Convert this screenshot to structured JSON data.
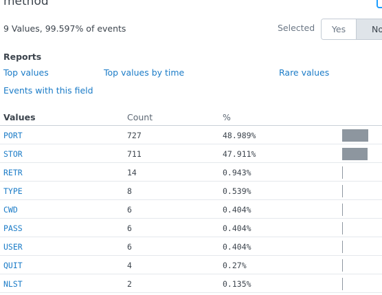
{
  "field_name": "method",
  "summary": "9 Values, 99.597% of events",
  "selected": {
    "label": "Selected",
    "yes": "Yes",
    "no": "No",
    "value": "No"
  },
  "reports": {
    "heading": "Reports",
    "links": [
      "Top values",
      "Top values by time",
      "Rare values",
      "Events with this field"
    ]
  },
  "table": {
    "headers": {
      "values": "Values",
      "count": "Count",
      "percent": "%"
    },
    "rows": [
      {
        "value": "PORT",
        "count": "727",
        "percent": "48.989%",
        "fraction": 0.48989
      },
      {
        "value": "STOR",
        "count": "711",
        "percent": "47.911%",
        "fraction": 0.47911
      },
      {
        "value": "RETR",
        "count": "14",
        "percent": "0.943%",
        "fraction": 0.00943
      },
      {
        "value": "TYPE",
        "count": "8",
        "percent": "0.539%",
        "fraction": 0.00539
      },
      {
        "value": "CWD",
        "count": "6",
        "percent": "0.404%",
        "fraction": 0.00404
      },
      {
        "value": "PASS",
        "count": "6",
        "percent": "0.404%",
        "fraction": 0.00404
      },
      {
        "value": "USER",
        "count": "6",
        "percent": "0.404%",
        "fraction": 0.00404
      },
      {
        "value": "QUIT",
        "count": "4",
        "percent": "0.27%",
        "fraction": 0.0027
      },
      {
        "value": "NLST",
        "count": "2",
        "percent": "0.135%",
        "fraction": 0.00135
      }
    ]
  },
  "colors": {
    "link": "#1a7bc7",
    "bar": "#8d969f",
    "accent": "#1a9cff"
  }
}
